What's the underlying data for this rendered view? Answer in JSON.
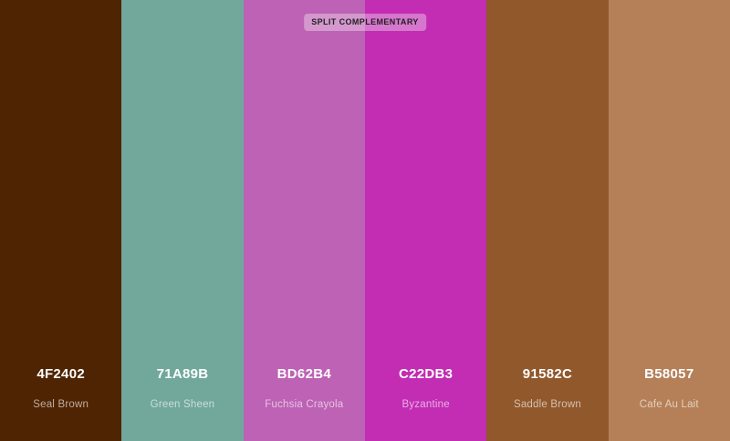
{
  "palette": {
    "badge_label": "SPLIT COMPLEMENTARY",
    "colors": [
      {
        "hex": "4F2402",
        "name": "Seal Brown",
        "color": "#4F2402"
      },
      {
        "hex": "71A89B",
        "name": "Green Sheen",
        "color": "#71A89B"
      },
      {
        "hex": "BD62B4",
        "name": "Fuchsia Crayola",
        "color": "#BD62B4"
      },
      {
        "hex": "C22DB3",
        "name": "Byzantine",
        "color": "#C22DB3"
      },
      {
        "hex": "91582C",
        "name": "Saddle Brown",
        "color": "#91582C"
      },
      {
        "hex": "B58057",
        "name": "Cafe Au Lait",
        "color": "#B58057"
      }
    ]
  }
}
